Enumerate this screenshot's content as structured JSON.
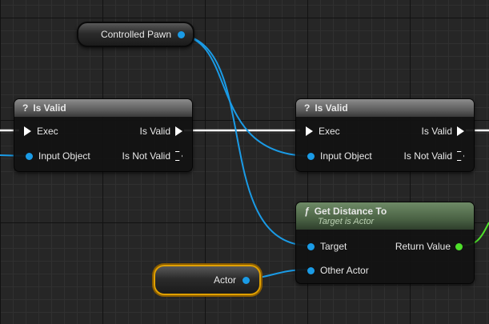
{
  "variables": [
    {
      "id": "controlled-pawn",
      "label": "Controlled Pawn",
      "selected": false
    },
    {
      "id": "actor",
      "label": "Actor",
      "selected": true
    }
  ],
  "nodes": {
    "is_valid_left": {
      "icon": "?",
      "title": "Is Valid",
      "exec_in": "Exec",
      "input": "Input Object",
      "out_valid": "Is Valid",
      "out_not_valid": "Is Not Valid"
    },
    "is_valid_right": {
      "icon": "?",
      "title": "Is Valid",
      "exec_in": "Exec",
      "input": "Input Object",
      "out_valid": "Is Valid",
      "out_not_valid": "Is Not Valid"
    },
    "get_distance": {
      "icon": "ƒ",
      "title": "Get Distance To",
      "subtitle": "Target is Actor",
      "target": "Target",
      "other": "Other Actor",
      "return": "Return Value"
    }
  },
  "colors": {
    "object_pin": "#1a9be6",
    "float_pin": "#4ee02a",
    "exec_wire": "#ffffff",
    "selected_outline": "#e0a000"
  }
}
